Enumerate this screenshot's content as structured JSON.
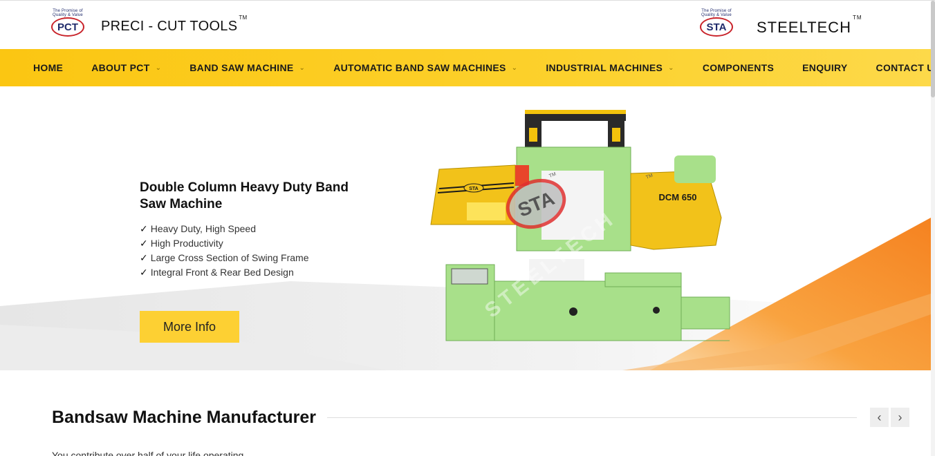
{
  "header": {
    "left_logo": {
      "seal_text": "PCT",
      "seal_arc": "The Promise of Quality & Value",
      "brand": "PRECI - CUT TOOLS",
      "tm": "TM"
    },
    "right_logo": {
      "seal_text": "STA",
      "seal_arc": "The Promise of Quality & Value",
      "brand": "STEELTECH",
      "tm": "TM"
    }
  },
  "nav": {
    "items": [
      {
        "label": "HOME",
        "dropdown": false
      },
      {
        "label": "ABOUT PCT",
        "dropdown": true
      },
      {
        "label": "BAND SAW MACHINE",
        "dropdown": true
      },
      {
        "label": "AUTOMATIC BAND SAW MACHINES",
        "dropdown": true
      },
      {
        "label": "INDUSTRIAL MACHINES",
        "dropdown": true
      },
      {
        "label": "COMPONENTS",
        "dropdown": false
      },
      {
        "label": "ENQUIRY",
        "dropdown": false
      },
      {
        "label": "CONTACT US",
        "dropdown": false
      }
    ],
    "chevron": "⌄"
  },
  "hero": {
    "title": "Double Column Heavy Duty Band Saw Machine",
    "check": "✓",
    "features": [
      "Heavy Duty, High Speed",
      "High Productivity",
      "Large Cross Section of Swing Frame",
      "Integral Front & Rear Bed Design"
    ],
    "button": "More Info",
    "machine": {
      "model": "DCM 650",
      "badge": "STA",
      "watermark": "STEELTECH",
      "tm": "TM"
    }
  },
  "section": {
    "title": "Bandsaw Machine Manufacturer",
    "prev": "‹",
    "next": "›",
    "text": "You contribute over half of your life operating"
  },
  "colors": {
    "accent": "#fdd033",
    "nav_bg": "#fbc612",
    "orange": "#f58220",
    "machine_green": "#a8e08a"
  }
}
